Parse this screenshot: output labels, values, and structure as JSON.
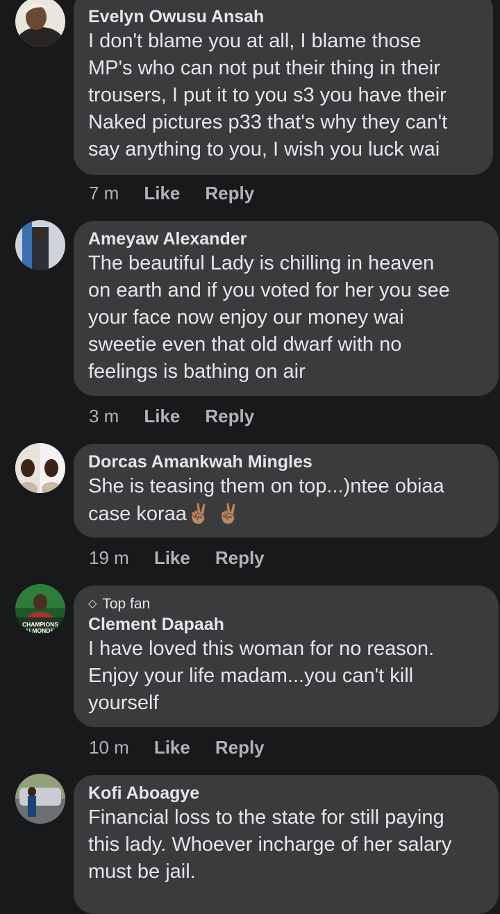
{
  "comments": [
    {
      "author": "Evelyn Owusu Ansah",
      "lines": [
        "I don't blame you at all, I blame those",
        "MP's who can not put their thing in their",
        "trousers, I put it to you s3 you have their",
        "Naked pictures p33 that's why they can't",
        "say anything to you, I wish you luck wai"
      ],
      "time": "7 m",
      "like": "Like",
      "reply": "Reply"
    },
    {
      "author": "Ameyaw Alexander",
      "lines": [
        "The beautiful Lady is chilling in heaven",
        "on earth and if you voted for her you see",
        "your face now enjoy our money wai",
        "sweetie even that old dwarf with no",
        "feelings is bathing on air"
      ],
      "time": "3 m",
      "like": "Like",
      "reply": "Reply"
    },
    {
      "author": "Dorcas Amankwah Mingles",
      "lines": [
        "She is teasing them on top...)ntee obiaa",
        "case koraa"
      ],
      "emoji": "✌🏽 ✌🏽",
      "time": "19 m",
      "like": "Like",
      "reply": "Reply"
    },
    {
      "badge": "Top fan",
      "author": "Clement Dapaah",
      "avatar_text": [
        "CHAMPIONS",
        "U MONDE"
      ],
      "lines": [
        "I have loved this woman for no reason.",
        "Enjoy your life madam...you can't kill",
        "yourself"
      ],
      "time": "10 m",
      "like": "Like",
      "reply": "Reply"
    },
    {
      "author": "Kofi Aboagye",
      "lines": [
        "Financial loss to the state for still paying",
        "this lady. Whoever incharge of her salary",
        "must be jail."
      ]
    }
  ],
  "colors": {
    "background": "#18191a",
    "bubble": "#3a3b3c",
    "text": "#e4e6eb",
    "secondary": "#b0b3b8"
  }
}
